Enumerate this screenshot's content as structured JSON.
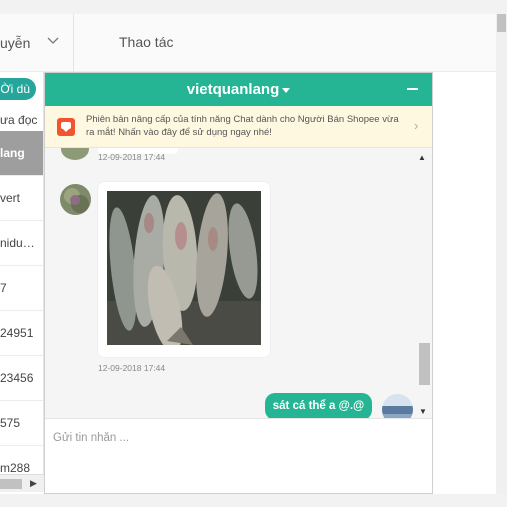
{
  "table_header": {
    "column_status": "uyễn",
    "column_actions": "Thao tác"
  },
  "conversation_list": {
    "active_filter": "Ời dù",
    "items": [
      {
        "label": "ưa đọc",
        "active": false
      },
      {
        "label": "lang",
        "active": true
      },
      {
        "label": "vert",
        "active": false
      },
      {
        "label": "nidu…",
        "active": false
      },
      {
        "label": "7",
        "active": false
      },
      {
        "label": "24951",
        "active": false
      },
      {
        "label": "23456",
        "active": false
      },
      {
        "label": "575",
        "active": false
      },
      {
        "label": "m288",
        "active": false
      }
    ]
  },
  "chat": {
    "title": "vietquanlang",
    "notice": "Phiên bản nâng cấp của tính năng Chat dành cho Người Bán Shopee vừa ra mắt! Nhấn vào đây để sử dụng ngay nhé!",
    "messages": [
      {
        "type": "timestamp",
        "text": "12-09-2018 17:44"
      },
      {
        "type": "image",
        "sender": "contact",
        "timestamp": "12-09-2018 17:44"
      },
      {
        "type": "text",
        "sender": "self",
        "text": "sát cá thể a @.@"
      }
    ],
    "input_placeholder": "Gửi tin nhắn ...",
    "input_value": ""
  },
  "colors": {
    "accent": "#26b594",
    "notice_bg": "#fff8e1",
    "notice_icon": "#f2542d",
    "active_item": "#9e9e9e"
  },
  "icons": {
    "dropdown": "chevron-down-icon",
    "minimize": "minimize-icon",
    "notice": "chat-bubble-icon",
    "notice_arrow": "chevron-right-icon"
  }
}
